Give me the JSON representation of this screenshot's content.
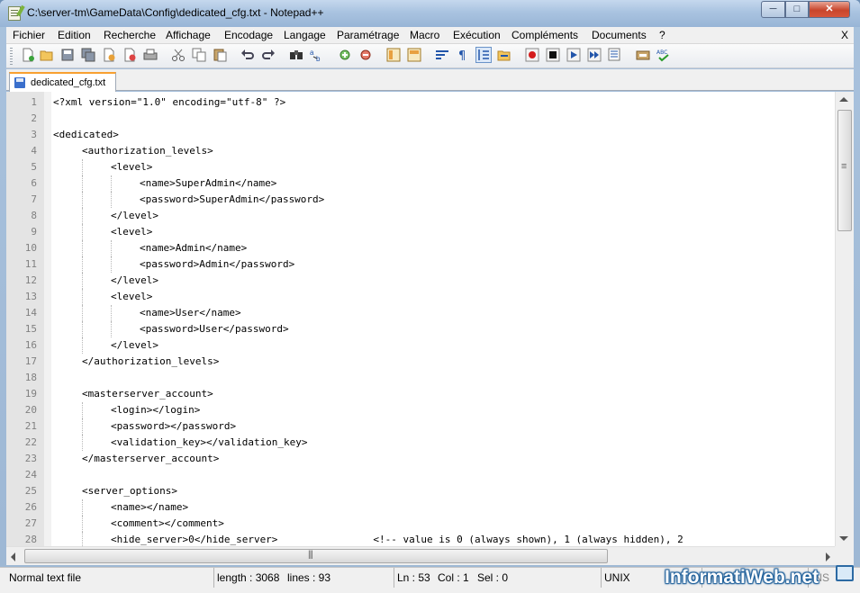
{
  "window": {
    "title": "C:\\server-tm\\GameData\\Config\\dedicated_cfg.txt - Notepad++"
  },
  "menu": {
    "items": [
      "Fichier",
      "Edition",
      "Recherche",
      "Affichage",
      "Encodage",
      "Langage",
      "Paramétrage",
      "Macro",
      "Exécution",
      "Compléments",
      "Documents",
      "?"
    ],
    "close_label": "X"
  },
  "toolbar": {
    "icons": [
      "new-file-icon",
      "open-file-icon",
      "save-icon",
      "save-all-icon",
      "close-icon",
      "close-all-icon",
      "print-icon",
      "cut-icon",
      "copy-icon",
      "paste-icon",
      "undo-icon",
      "redo-icon",
      "find-icon",
      "replace-icon",
      "zoom-in-icon",
      "zoom-out-icon",
      "sync-vertical-icon",
      "sync-horizontal-icon",
      "word-wrap-icon",
      "show-all-chars-icon",
      "indent-guide-icon",
      "folder-icon",
      "record-macro-icon",
      "stop-macro-icon",
      "play-macro-icon",
      "run-macro-multiple-icon",
      "save-macro-icon",
      "launch-icon",
      "spell-check-icon"
    ]
  },
  "tab": {
    "label": "dedicated_cfg.txt"
  },
  "editor": {
    "lines": [
      {
        "n": "1",
        "indent": 0,
        "text": "<?xml version=\"1.0\" encoding=\"utf-8\" ?>"
      },
      {
        "n": "2",
        "indent": 0,
        "text": ""
      },
      {
        "n": "3",
        "indent": 0,
        "text": "<dedicated>"
      },
      {
        "n": "4",
        "indent": 1,
        "text": "<authorization_levels>"
      },
      {
        "n": "5",
        "indent": 2,
        "text": "<level>"
      },
      {
        "n": "6",
        "indent": 3,
        "text": "<name>SuperAdmin</name>"
      },
      {
        "n": "7",
        "indent": 3,
        "text": "<password>SuperAdmin</password>"
      },
      {
        "n": "8",
        "indent": 2,
        "text": "</level>"
      },
      {
        "n": "9",
        "indent": 2,
        "text": "<level>"
      },
      {
        "n": "10",
        "indent": 3,
        "text": "<name>Admin</name>"
      },
      {
        "n": "11",
        "indent": 3,
        "text": "<password>Admin</password>"
      },
      {
        "n": "12",
        "indent": 2,
        "text": "</level>"
      },
      {
        "n": "13",
        "indent": 2,
        "text": "<level>"
      },
      {
        "n": "14",
        "indent": 3,
        "text": "<name>User</name>"
      },
      {
        "n": "15",
        "indent": 3,
        "text": "<password>User</password>"
      },
      {
        "n": "16",
        "indent": 2,
        "text": "</level>"
      },
      {
        "n": "17",
        "indent": 1,
        "text": "</authorization_levels>"
      },
      {
        "n": "18",
        "indent": 0,
        "text": ""
      },
      {
        "n": "19",
        "indent": 1,
        "text": "<masterserver_account>"
      },
      {
        "n": "20",
        "indent": 2,
        "text": "<login></login>"
      },
      {
        "n": "21",
        "indent": 2,
        "text": "<password></password>"
      },
      {
        "n": "22",
        "indent": 2,
        "text": "<validation_key></validation_key>"
      },
      {
        "n": "23",
        "indent": 1,
        "text": "</masterserver_account>"
      },
      {
        "n": "24",
        "indent": 0,
        "text": ""
      },
      {
        "n": "25",
        "indent": 1,
        "text": "<server_options>"
      },
      {
        "n": "26",
        "indent": 2,
        "text": "<name></name>"
      },
      {
        "n": "27",
        "indent": 2,
        "text": "<comment></comment>"
      },
      {
        "n": "28",
        "indent": 2,
        "text": "<hide_server>0</hide_server>                <!-- value is 0 (always shown), 1 (always hidden), 2"
      }
    ]
  },
  "status": {
    "file_type": "Normal text file",
    "length": "length : 3068",
    "lines": "lines : 93",
    "ln": "Ln : 53",
    "col": "Col : 1",
    "sel": "Sel : 0",
    "eol": "UNIX",
    "encoding": "UTF-8",
    "mode": "INS"
  },
  "watermark": {
    "text": "InformatiWeb.net"
  }
}
